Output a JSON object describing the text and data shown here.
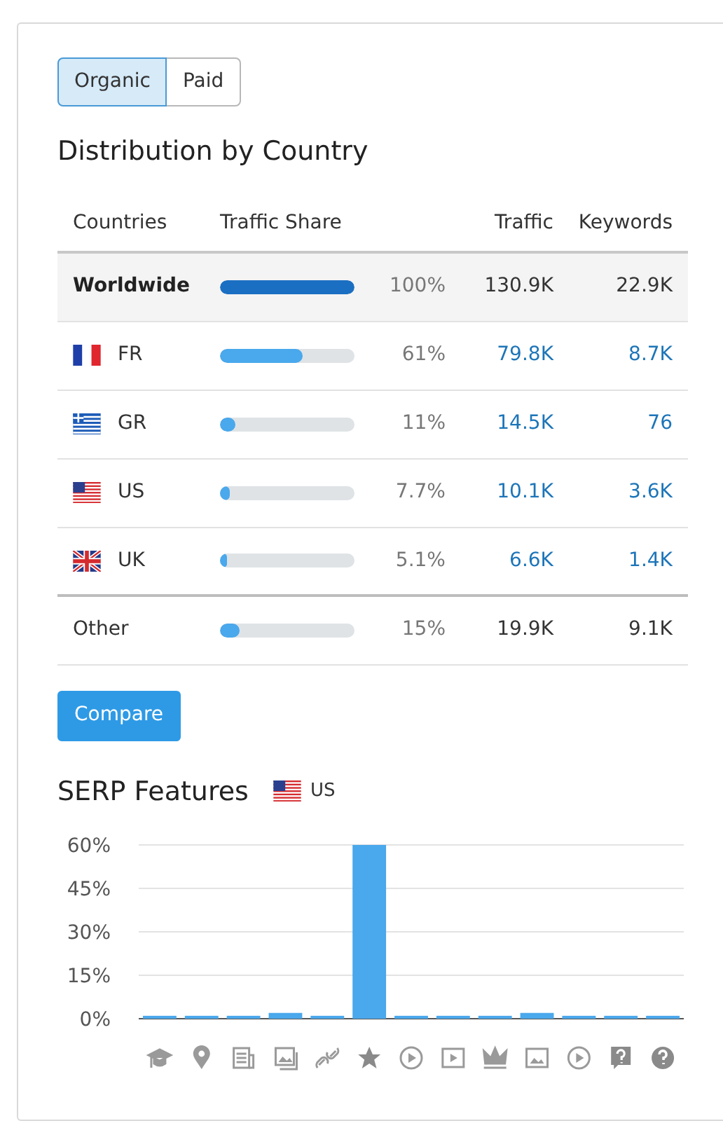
{
  "tabs": [
    {
      "label": "Organic",
      "selected": true
    },
    {
      "label": "Paid",
      "selected": false
    }
  ],
  "distribution": {
    "title": "Distribution by Country",
    "columns": [
      "Countries",
      "Traffic Share",
      "Traffic",
      "Keywords"
    ],
    "rows": [
      {
        "kind": "total",
        "country": "Worldwide",
        "level": 1.0,
        "share": "100%",
        "traffic": "130.9K",
        "keywords": "22.9K"
      },
      {
        "kind": "country",
        "country": "FR",
        "level": 0.61,
        "share": "61%",
        "traffic": "79.8K",
        "keywords": "8.7K"
      },
      {
        "kind": "country",
        "country": "GR",
        "level": 0.11,
        "share": "11%",
        "traffic": "14.5K",
        "keywords": "76"
      },
      {
        "kind": "country",
        "country": "US",
        "level": 0.077,
        "share": "7.7%",
        "traffic": "10.1K",
        "keywords": "3.6K"
      },
      {
        "kind": "country",
        "country": "UK",
        "level": 0.051,
        "share": "5.1%",
        "traffic": "6.6K",
        "keywords": "1.4K"
      },
      {
        "kind": "other",
        "country": "Other",
        "level": 0.15,
        "share": "15%",
        "traffic": "19.9K",
        "keywords": "9.1K"
      }
    ]
  },
  "compare_button": "Compare",
  "serp": {
    "title": "SERP Features",
    "country": "US",
    "chart_data": {
      "type": "bar",
      "grid": true,
      "ylim": [
        0,
        60
      ],
      "yticks": [
        {
          "value": 0,
          "label": "0%"
        },
        {
          "value": 15,
          "label": "15%"
        },
        {
          "value": 30,
          "label": "30%"
        },
        {
          "value": 45,
          "label": "45%"
        },
        {
          "value": 60,
          "label": "60%"
        }
      ],
      "values": [
        1,
        1,
        1,
        2,
        1,
        60,
        1,
        1,
        1,
        2,
        1,
        1,
        1
      ]
    }
  }
}
